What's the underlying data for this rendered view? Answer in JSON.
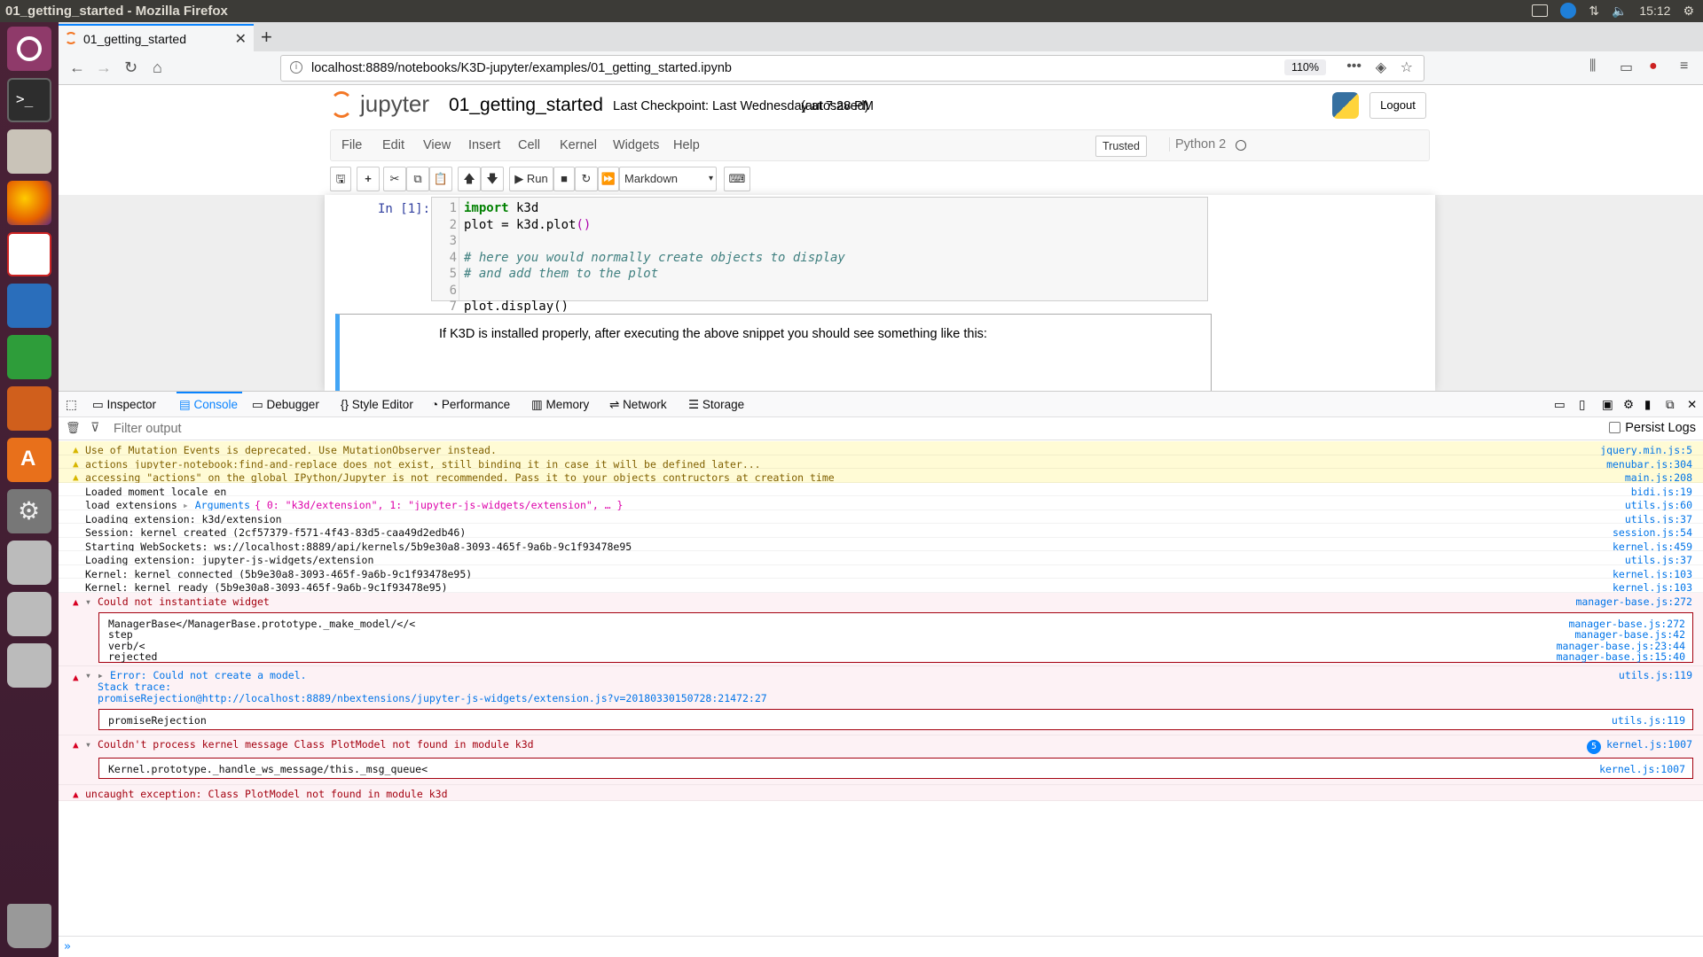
{
  "system": {
    "window_title": "01_getting_started - Mozilla Firefox",
    "clock": "15:12"
  },
  "launcher": {
    "items": [
      "ubuntu-home-icon",
      "terminal-icon",
      "file-manager-icon",
      "firefox-icon",
      "document-viewer-icon",
      "writer-icon",
      "calc-icon",
      "impress-icon",
      "software-center-icon",
      "settings-icon",
      "drive-icon-1",
      "drive-icon-2",
      "drive-icon-3",
      "trash-icon"
    ]
  },
  "browser": {
    "tab_title": "01_getting_started",
    "url": "localhost:8889/notebooks/K3D-jupyter/examples/01_getting_started.ipynb",
    "zoom": "110%",
    "more": "•••"
  },
  "jupyter": {
    "logo_text": "jupyter",
    "notebook_name": "01_getting_started",
    "checkpoint": "Last Checkpoint: Last Wednesday at 7:28 PM",
    "autosaved": "(autosaved)",
    "logout": "Logout",
    "menu": [
      "File",
      "Edit",
      "View",
      "Insert",
      "Cell",
      "Kernel",
      "Widgets",
      "Help"
    ],
    "trusted": "Trusted",
    "kernel": "Python 2",
    "run_label": "Run",
    "cell_type": "Markdown",
    "prompt": "In [1]:",
    "code_lines": [
      {
        "n": "1",
        "parts": [
          {
            "t": "import",
            "c": "kw"
          },
          {
            "t": " k3d",
            "c": ""
          }
        ]
      },
      {
        "n": "2",
        "parts": [
          {
            "t": "plot = k3d.plot",
            "c": ""
          },
          {
            "t": "()",
            "c": "br"
          }
        ]
      },
      {
        "n": "3",
        "parts": []
      },
      {
        "n": "4",
        "parts": [
          {
            "t": "# here you would normally create objects to display",
            "c": "cm"
          }
        ]
      },
      {
        "n": "5",
        "parts": [
          {
            "t": "# and add them to the plot",
            "c": "cm"
          }
        ]
      },
      {
        "n": "6",
        "parts": []
      },
      {
        "n": "7",
        "parts": [
          {
            "t": "plot.display()",
            "c": ""
          }
        ]
      }
    ],
    "markdown_text": "If K3D is installed properly, after executing the above snippet you should see something like this:"
  },
  "devtools": {
    "tabs": [
      "Inspector",
      "Console",
      "Debugger",
      "Style Editor",
      "Performance",
      "Memory",
      "Network",
      "Storage"
    ],
    "selected_tab": "Console",
    "filter_placeholder": "Filter output",
    "persist_logs": "Persist Logs",
    "warnings": [
      {
        "msg": "Use of Mutation Events is deprecated. Use MutationObserver instead.",
        "src": "jquery.min.js:5"
      },
      {
        "msg": "actions jupyter-notebook:find-and-replace does not exist, still binding it in case it will be defined later...",
        "src": "menubar.js:304"
      },
      {
        "msg": "accessing \"actions\" on the global IPython/Jupyter is not recommended. Pass it to your objects contructors at creation time",
        "src": "main.js:208"
      }
    ],
    "logs": [
      {
        "msg": "Loaded moment locale en",
        "src": "bidi.js:19"
      },
      {
        "msg": "load_extensions",
        "src": "utils.js:60",
        "args_label": "Arguments",
        "args_value": "{ 0: \"k3d/extension\", 1: \"jupyter-js-widgets/extension\", … }"
      },
      {
        "msg": "Loading extension: k3d/extension",
        "src": "utils.js:37"
      },
      {
        "msg": "Session: kernel_created (2cf57379-f571-4f43-83d5-caa49d2edb46)",
        "src": "session.js:54"
      },
      {
        "msg": "Starting WebSockets: ws://localhost:8889/api/kernels/5b9e30a8-3093-465f-9a6b-9c1f93478e95",
        "src": "kernel.js:459"
      },
      {
        "msg": "Loading extension: jupyter-js-widgets/extension",
        "src": "utils.js:37"
      },
      {
        "msg": "Kernel: kernel_connected (5b9e30a8-3093-465f-9a6b-9c1f93478e95)",
        "src": "kernel.js:103"
      },
      {
        "msg": "Kernel: kernel_ready (5b9e30a8-3093-465f-9a6b-9c1f93478e95)",
        "src": "kernel.js:103"
      }
    ],
    "error1": {
      "msg": "Could not instantiate widget",
      "src": "manager-base.js:272",
      "stack": [
        {
          "fn": "ManagerBase</ManagerBase.prototype._make_model/</<",
          "src": "manager-base.js:272"
        },
        {
          "fn": "step",
          "src": "manager-base.js:42"
        },
        {
          "fn": "verb/<",
          "src": "manager-base.js:23:44"
        },
        {
          "fn": "rejected",
          "src": "manager-base.js:15:40"
        }
      ]
    },
    "error2": {
      "msg": "Error: Could not create a model.",
      "src": "utils.js:119",
      "trace_label": "Stack trace:",
      "trace": "promiseRejection@http://localhost:8889/nbextensions/jupyter-js-widgets/extension.js?v=20180330150728:21472:27",
      "box_fn": "promiseRejection",
      "box_src": "utils.js:119"
    },
    "error3": {
      "msg": "Couldn't process kernel message Class PlotModel not found in module k3d",
      "src": "kernel.js:1007",
      "count": "5",
      "box_fn": "Kernel.prototype._handle_ws_message/this._msg_queue<",
      "box_src": "kernel.js:1007"
    },
    "error4": {
      "msg": "uncaught exception: Class PlotModel not found in module k3d"
    },
    "input_prompt": "»"
  }
}
